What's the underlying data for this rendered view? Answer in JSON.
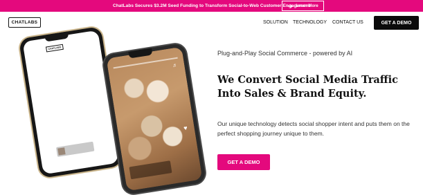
{
  "announcement": {
    "text": "ChatLabs Secures $3.2M Seed Funding to Transform Social-to-Web Customer Engagement",
    "button_label": "Learn More"
  },
  "nav": {
    "logo": "CHATLABS",
    "links": [
      "SOLUTION",
      "TECHNOLOGY",
      "CONTACT US"
    ],
    "cta": "GET A DEMO"
  },
  "hero": {
    "tagline": "Plug-and-Play Social Commerce - powered by AI",
    "headline": "We Convert Social Media Traffic Into Sales & Brand Equity.",
    "description": "Our unique technology detects social shopper intent and puts them on the perfect shopping journey unique to them.",
    "cta": "GET A DEMO"
  },
  "phones": {
    "back_logo": "CHATLABS"
  },
  "colors": {
    "brand_pink": "#e4097d",
    "dark": "#0b0b0b"
  },
  "icons": [
    "arrow-right-icon",
    "heart-icon",
    "speaker-icon"
  ]
}
